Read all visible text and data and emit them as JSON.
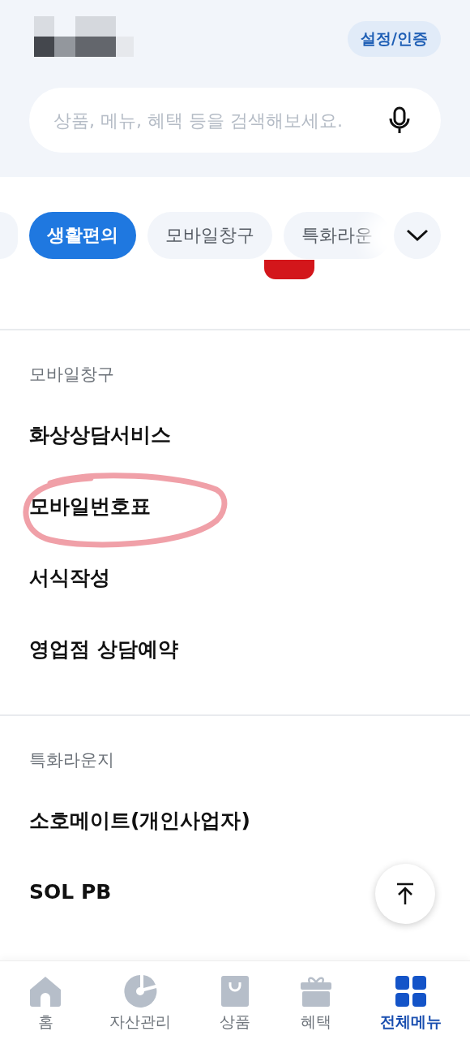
{
  "header": {
    "settings_button": "설정/인증",
    "search": {
      "placeholder": "상품, 메뉴, 혜택 등을 검색해보세요."
    }
  },
  "chips": [
    {
      "selected": false
    },
    {
      "label": "생활편의",
      "selected": true
    },
    {
      "label": "모바일창구",
      "selected": false
    },
    {
      "label": "특화라운",
      "selected": false
    }
  ],
  "sections": [
    {
      "title": "모바일창구",
      "items": [
        {
          "label": "화상상담서비스",
          "circled": false
        },
        {
          "label": "모바일번호표",
          "circled": true
        },
        {
          "label": "서식작성",
          "circled": false
        },
        {
          "label": "영업점 상담예약",
          "circled": false
        }
      ]
    },
    {
      "title": "특화라운지",
      "items": [
        {
          "label": "소호메이트(개인사업자)",
          "circled": false
        },
        {
          "label": "SOL PB",
          "circled": false
        }
      ]
    }
  ],
  "bottom_nav": [
    {
      "kind": "home",
      "label": "홈",
      "selected": false
    },
    {
      "kind": "assets",
      "label": "자산관리",
      "selected": false
    },
    {
      "kind": "products",
      "label": "상품",
      "selected": false
    },
    {
      "kind": "benefits",
      "label": "혜택",
      "selected": false
    },
    {
      "kind": "menu",
      "label": "전체메뉴",
      "selected": true
    }
  ]
}
